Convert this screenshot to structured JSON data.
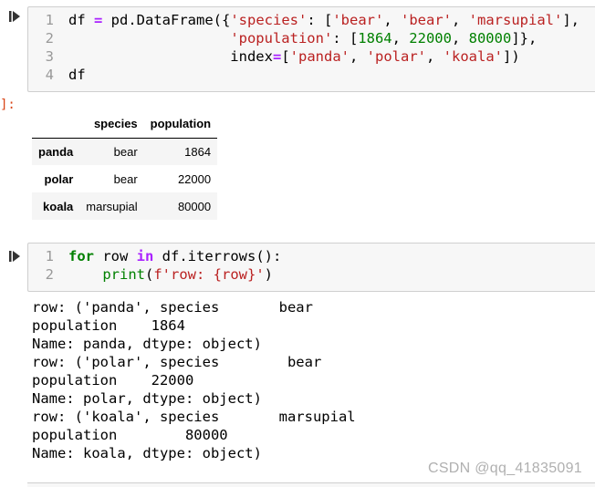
{
  "cells": [
    {
      "id": "cell-1",
      "out_prompt": "]:",
      "code_lines": [
        {
          "n": "1",
          "tokens": [
            {
              "t": "df ",
              "c": ""
            },
            {
              "t": "=",
              "c": "op"
            },
            {
              "t": " pd.DataFrame({",
              "c": ""
            },
            {
              "t": "'species'",
              "c": "str"
            },
            {
              "t": ": [",
              "c": ""
            },
            {
              "t": "'bear'",
              "c": "str"
            },
            {
              "t": ", ",
              "c": ""
            },
            {
              "t": "'bear'",
              "c": "str"
            },
            {
              "t": ", ",
              "c": ""
            },
            {
              "t": "'marsupial'",
              "c": "str"
            },
            {
              "t": "],",
              "c": ""
            }
          ]
        },
        {
          "n": "2",
          "tokens": [
            {
              "t": "                   ",
              "c": ""
            },
            {
              "t": "'population'",
              "c": "str"
            },
            {
              "t": ": [",
              "c": ""
            },
            {
              "t": "1864",
              "c": "num"
            },
            {
              "t": ", ",
              "c": ""
            },
            {
              "t": "22000",
              "c": "num"
            },
            {
              "t": ", ",
              "c": ""
            },
            {
              "t": "80000",
              "c": "num"
            },
            {
              "t": "]},",
              "c": ""
            }
          ]
        },
        {
          "n": "3",
          "tokens": [
            {
              "t": "                   index",
              "c": ""
            },
            {
              "t": "=",
              "c": "op"
            },
            {
              "t": "[",
              "c": ""
            },
            {
              "t": "'panda'",
              "c": "str"
            },
            {
              "t": ", ",
              "c": ""
            },
            {
              "t": "'polar'",
              "c": "str"
            },
            {
              "t": ", ",
              "c": ""
            },
            {
              "t": "'koala'",
              "c": "str"
            },
            {
              "t": "])",
              "c": ""
            }
          ]
        },
        {
          "n": "4",
          "tokens": [
            {
              "t": "df",
              "c": ""
            }
          ]
        }
      ],
      "table": {
        "columns": [
          "species",
          "population"
        ],
        "rows": [
          {
            "index": "panda",
            "values": [
              "bear",
              "1864"
            ]
          },
          {
            "index": "polar",
            "values": [
              "bear",
              "22000"
            ]
          },
          {
            "index": "koala",
            "values": [
              "marsupial",
              "80000"
            ]
          }
        ]
      }
    },
    {
      "id": "cell-2",
      "code_lines": [
        {
          "n": "1",
          "tokens": [
            {
              "t": "for",
              "c": "kw"
            },
            {
              "t": " row ",
              "c": ""
            },
            {
              "t": "in",
              "c": "op"
            },
            {
              "t": " df.iterrows():",
              "c": ""
            }
          ]
        },
        {
          "n": "2",
          "tokens": [
            {
              "t": "    ",
              "c": ""
            },
            {
              "t": "print",
              "c": "num"
            },
            {
              "t": "(",
              "c": ""
            },
            {
              "t": "f'row: {row}'",
              "c": "str"
            },
            {
              "t": ")",
              "c": ""
            }
          ]
        }
      ],
      "output_lines": [
        "row: ('panda', species       bear",
        "population    1864",
        "Name: panda, dtype: object)",
        "row: ('polar', species        bear",
        "population    22000",
        "Name: polar, dtype: object)",
        "row: ('koala', species       marsupial",
        "population        80000",
        "Name: koala, dtype: object)"
      ]
    }
  ],
  "watermark": "CSDN @qq_41835091",
  "icons": {
    "run": "run-cell-icon"
  }
}
